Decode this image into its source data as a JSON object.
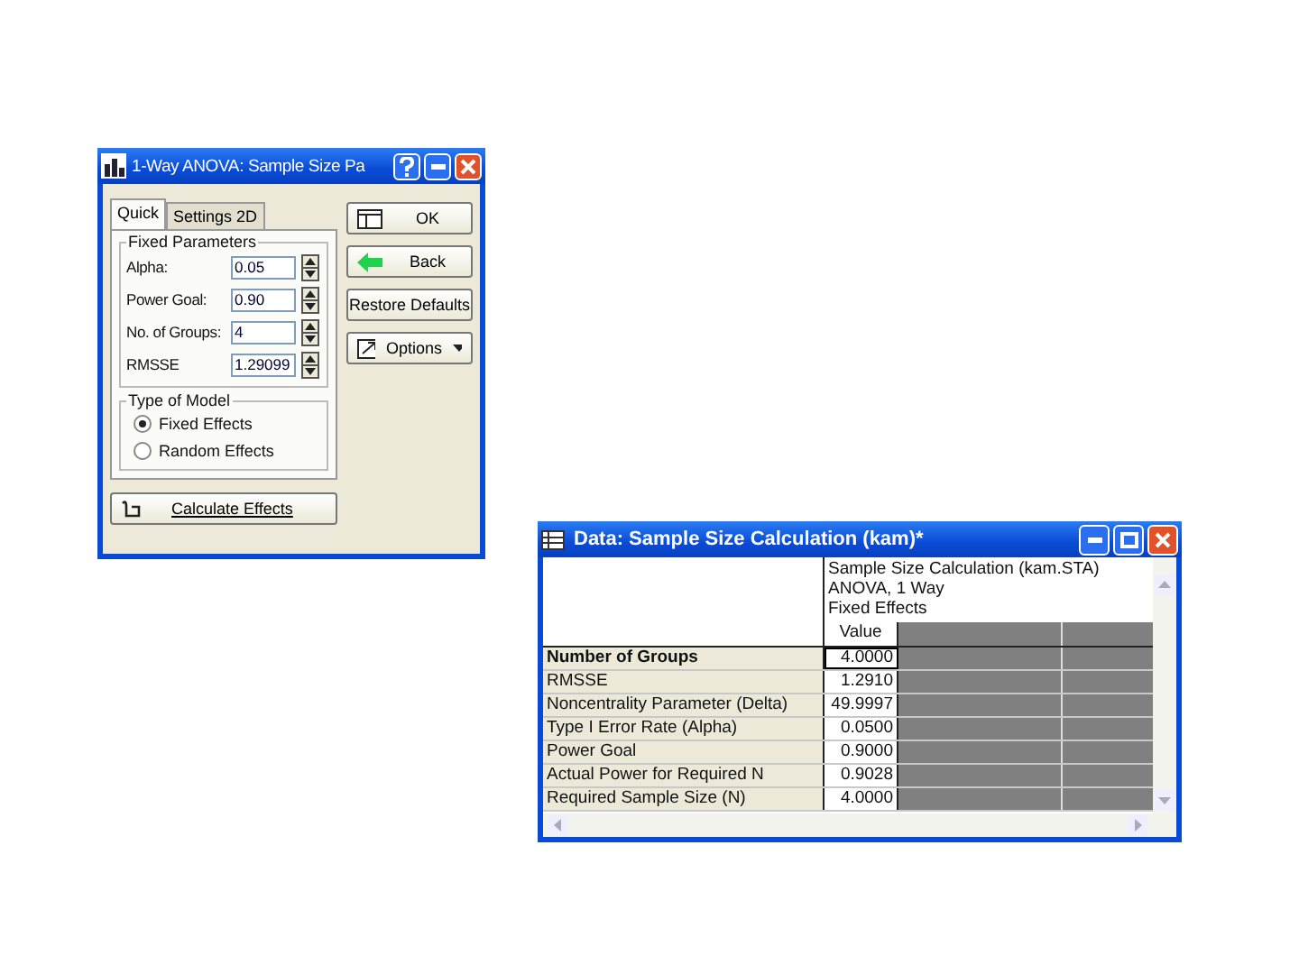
{
  "dialog": {
    "title": "1-Way ANOVA: Sample Size Pa",
    "tabs": [
      {
        "label": "Quick",
        "selected": true
      },
      {
        "label": "Settings 2D",
        "selected": false
      }
    ],
    "fixed_parameters": {
      "title": "Fixed Parameters",
      "fields": [
        {
          "label": "Alpha:",
          "value": "0.05"
        },
        {
          "label": "Power Goal:",
          "value": "0.90"
        },
        {
          "label": "No. of Groups:",
          "value": "4"
        },
        {
          "label": "RMSSE",
          "value": "1.29099"
        }
      ]
    },
    "model_type": {
      "title": "Type of Model",
      "options": [
        {
          "label": "Fixed Effects",
          "selected": true
        },
        {
          "label": "Random Effects",
          "selected": false
        }
      ]
    },
    "calculate_button": "Calculate Effects",
    "buttons": [
      {
        "kind": "ok",
        "label": "OK"
      },
      {
        "kind": "back",
        "label": "Back"
      },
      {
        "kind": "plain",
        "label": "Restore Defaults"
      },
      {
        "kind": "options",
        "label": "Options"
      }
    ]
  },
  "data_window": {
    "title": "Data: Sample Size Calculation (kam)*",
    "header_lines": [
      "Sample Size Calculation (kam.STA)",
      "ANOVA, 1 Way",
      "Fixed Effects"
    ],
    "column": "Value",
    "rows": [
      {
        "label": "Number of Groups",
        "value": "4.0000",
        "selected": true
      },
      {
        "label": "RMSSE",
        "value": "1.2910",
        "selected": false
      },
      {
        "label": "Noncentrality Parameter (Delta)",
        "value": "49.9997",
        "selected": false
      },
      {
        "label": "Type I Error Rate (Alpha)",
        "value": "0.0500",
        "selected": false
      },
      {
        "label": "Power Goal",
        "value": "0.9000",
        "selected": false
      },
      {
        "label": "Actual Power for Required N",
        "value": "0.9028",
        "selected": false
      },
      {
        "label": "Required Sample Size (N)",
        "value": "4.0000",
        "selected": false
      }
    ]
  }
}
